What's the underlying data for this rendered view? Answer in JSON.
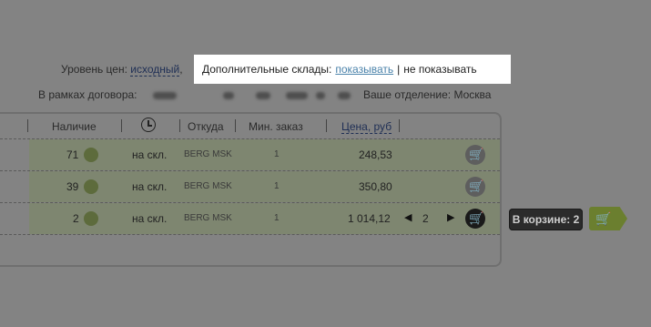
{
  "price_level": {
    "label": "Уровень цен:",
    "value": "исходный",
    "sep": ","
  },
  "extra_warehouses": {
    "label": "Дополнительные склады:",
    "show": "показывать",
    "divider": "|",
    "hide": "не показывать"
  },
  "contract": {
    "label": "В рамках договора:"
  },
  "branch": {
    "label": "Ваше отделение:",
    "value": "Москва"
  },
  "table": {
    "headers": {
      "stock": "Наличие",
      "from": "Откуда",
      "min_order": "Мин. заказ",
      "price": "Цена, руб"
    },
    "rows": [
      {
        "qty": "71",
        "where": "на скл.",
        "source": "BERG MSK",
        "min": "1",
        "price": "248,53"
      },
      {
        "qty": "39",
        "where": "на скл.",
        "source": "BERG MSK",
        "min": "1",
        "price": "350,80"
      },
      {
        "qty": "2",
        "where": "на скл.",
        "source": "BERG MSK",
        "min": "1",
        "price": "1 014,12",
        "in_cart": "2"
      }
    ]
  },
  "in_cart": {
    "label": "В корзине: 2"
  },
  "icons": {
    "clock": "clock-icon",
    "cart": "cart-icon",
    "stock": "stock-status-icon"
  },
  "colors": {
    "background": "#838383",
    "row_green": "#7e8670",
    "badge": "#2b2b2b",
    "cart_tag": "#6b7f2f",
    "link": "#4a82aa"
  }
}
